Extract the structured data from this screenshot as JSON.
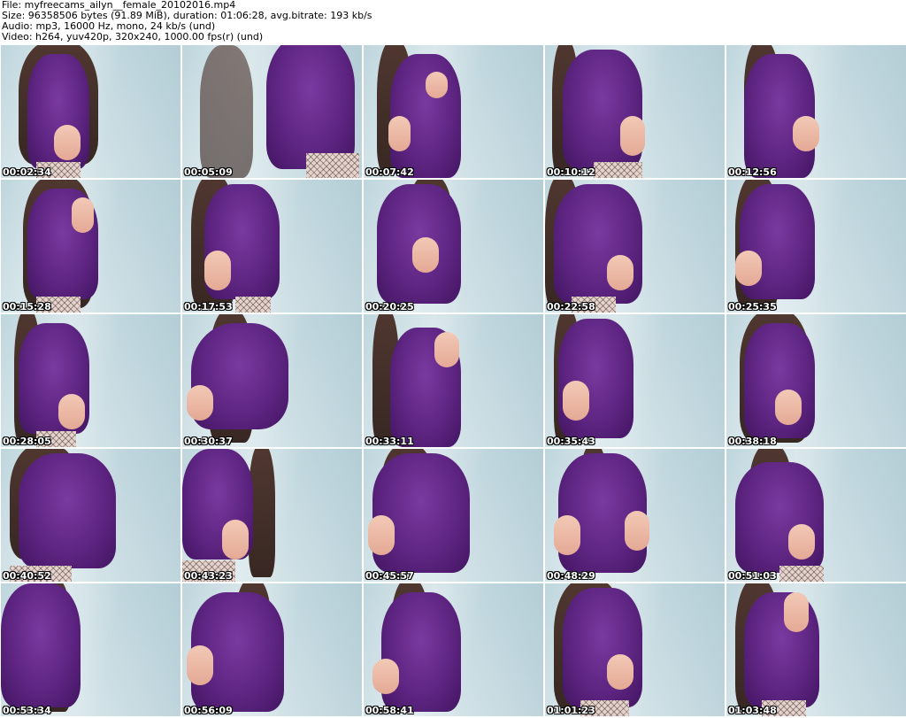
{
  "header": {
    "file_line": "File: myfreecams_ailyn__female_20102016.mp4",
    "size_line": "Size: 96358506 bytes (91.89 MiB), duration: 01:06:28, avg.bitrate: 193 kb/s",
    "audio_line": "Audio: mp3, 16000 Hz, mono, 24 kb/s (und)",
    "video_line": "Video: h264, yuv420p, 320x240, 1000.00 fps(r) (und)"
  },
  "thumbnails": [
    {
      "timestamp": "00:02:34"
    },
    {
      "timestamp": "00:05:09"
    },
    {
      "timestamp": "00:07:42"
    },
    {
      "timestamp": "00:10:12"
    },
    {
      "timestamp": "00:12:56"
    },
    {
      "timestamp": "00:15:28"
    },
    {
      "timestamp": "00:17:53"
    },
    {
      "timestamp": "00:20:25"
    },
    {
      "timestamp": "00:22:58"
    },
    {
      "timestamp": "00:25:35"
    },
    {
      "timestamp": "00:28:05"
    },
    {
      "timestamp": "00:30:37"
    },
    {
      "timestamp": "00:33:11"
    },
    {
      "timestamp": "00:35:43"
    },
    {
      "timestamp": "00:38:18"
    },
    {
      "timestamp": "00:40:52"
    },
    {
      "timestamp": "00:43:23"
    },
    {
      "timestamp": "00:45:57"
    },
    {
      "timestamp": "00:48:29"
    },
    {
      "timestamp": "00:51:03"
    },
    {
      "timestamp": "00:53:34"
    },
    {
      "timestamp": "00:56:09"
    },
    {
      "timestamp": "00:58:41"
    },
    {
      "timestamp": "01:01:23"
    },
    {
      "timestamp": "01:03:48"
    }
  ]
}
